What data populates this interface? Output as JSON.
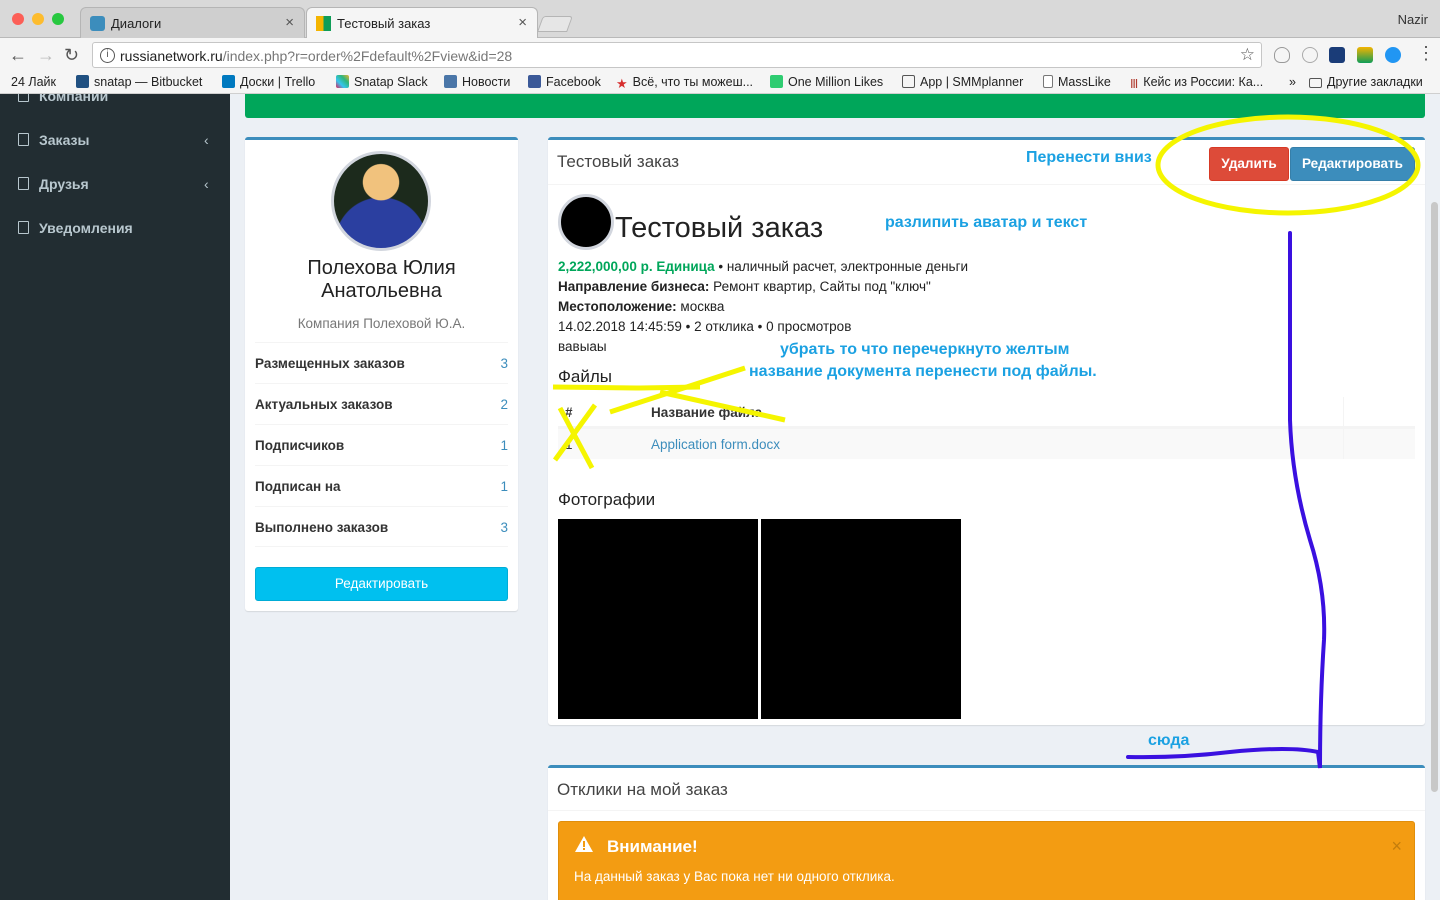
{
  "browser": {
    "tabs": [
      {
        "label": "Диалоги",
        "active": false
      },
      {
        "label": "Тестовый заказ",
        "active": true
      }
    ],
    "user": "Nazir",
    "url_host": "russianetwork.ru",
    "url_rest": "/index.php?r=order%2Fdefault%2Fview&id=28",
    "bookmarks": [
      "24 Лайк",
      "snatap — Bitbucket",
      "Доски | Trello",
      "Snatap Slack",
      "Новости",
      "Facebook",
      "Всё, что ты можеш...",
      "One Million Likes",
      "App | SMMplanner",
      "MassLike",
      "Кейс из России: Ка...",
      "»",
      "Другие закладки"
    ]
  },
  "sidebar": {
    "items": [
      {
        "label": "Компании",
        "chevron": ""
      },
      {
        "label": "Заказы",
        "chevron": "‹"
      },
      {
        "label": "Друзья",
        "chevron": "‹"
      },
      {
        "label": "Уведомления",
        "chevron": ""
      }
    ]
  },
  "profile": {
    "name": "Полехова Юлия Анатольевна",
    "company": "Компания Полеховой Ю.А.",
    "stats": [
      {
        "label": "Размещенных заказов",
        "value": "3"
      },
      {
        "label": "Актуальных заказов",
        "value": "2"
      },
      {
        "label": "Подписчиков",
        "value": "1"
      },
      {
        "label": "Подписан на",
        "value": "1"
      },
      {
        "label": "Выполнено заказов",
        "value": "3"
      }
    ],
    "edit_label": "Редактировать"
  },
  "order": {
    "box_title": "Тестовый заказ",
    "delete_label": "Удалить",
    "edit_label": "Редактировать",
    "title": "Тестовый заказ",
    "price": "2,222,000,00 р. Единица",
    "payment": " • наличный расчет, электронные деньги",
    "direction_label": "Направление бизнеса:",
    "direction_value": " Ремонт квартир, Сайты под \"ключ\"",
    "location_label": "Местоположение:",
    "location_value": " москва",
    "meta": "14.02.2018 14:45:59 • 2 отклика • 0 просмотров",
    "description": "вавыаы",
    "files_heading": "Файлы",
    "files_table": {
      "headers": [
        "#",
        "Название файла"
      ],
      "rows": [
        [
          "1",
          "Application form.docx"
        ]
      ]
    },
    "photos_heading": "Фотографии"
  },
  "replies": {
    "title": "Отклики на мой заказ",
    "alert_title": "Внимание!",
    "alert_text": "На данный заказ у Вас пока нет ни одного отклика.",
    "alert_close": "×"
  },
  "annotations": {
    "move_down": "Перенести вниз",
    "separate": "разлипить аватар и текст",
    "remove_line1": "убрать  то что перечеркнуто желтым",
    "remove_line2": "название документа перенести под  файлы.",
    "here": "сюда"
  },
  "colors": {
    "green_bar": "#00a65a",
    "primary": "#3c8dbc",
    "danger": "#dd4b39",
    "info": "#00c0ef",
    "warning": "#f39c12",
    "annotation_text": "#1ba1e2",
    "annotation_yellow": "#f5f500",
    "annotation_line": "#3a10e0"
  }
}
